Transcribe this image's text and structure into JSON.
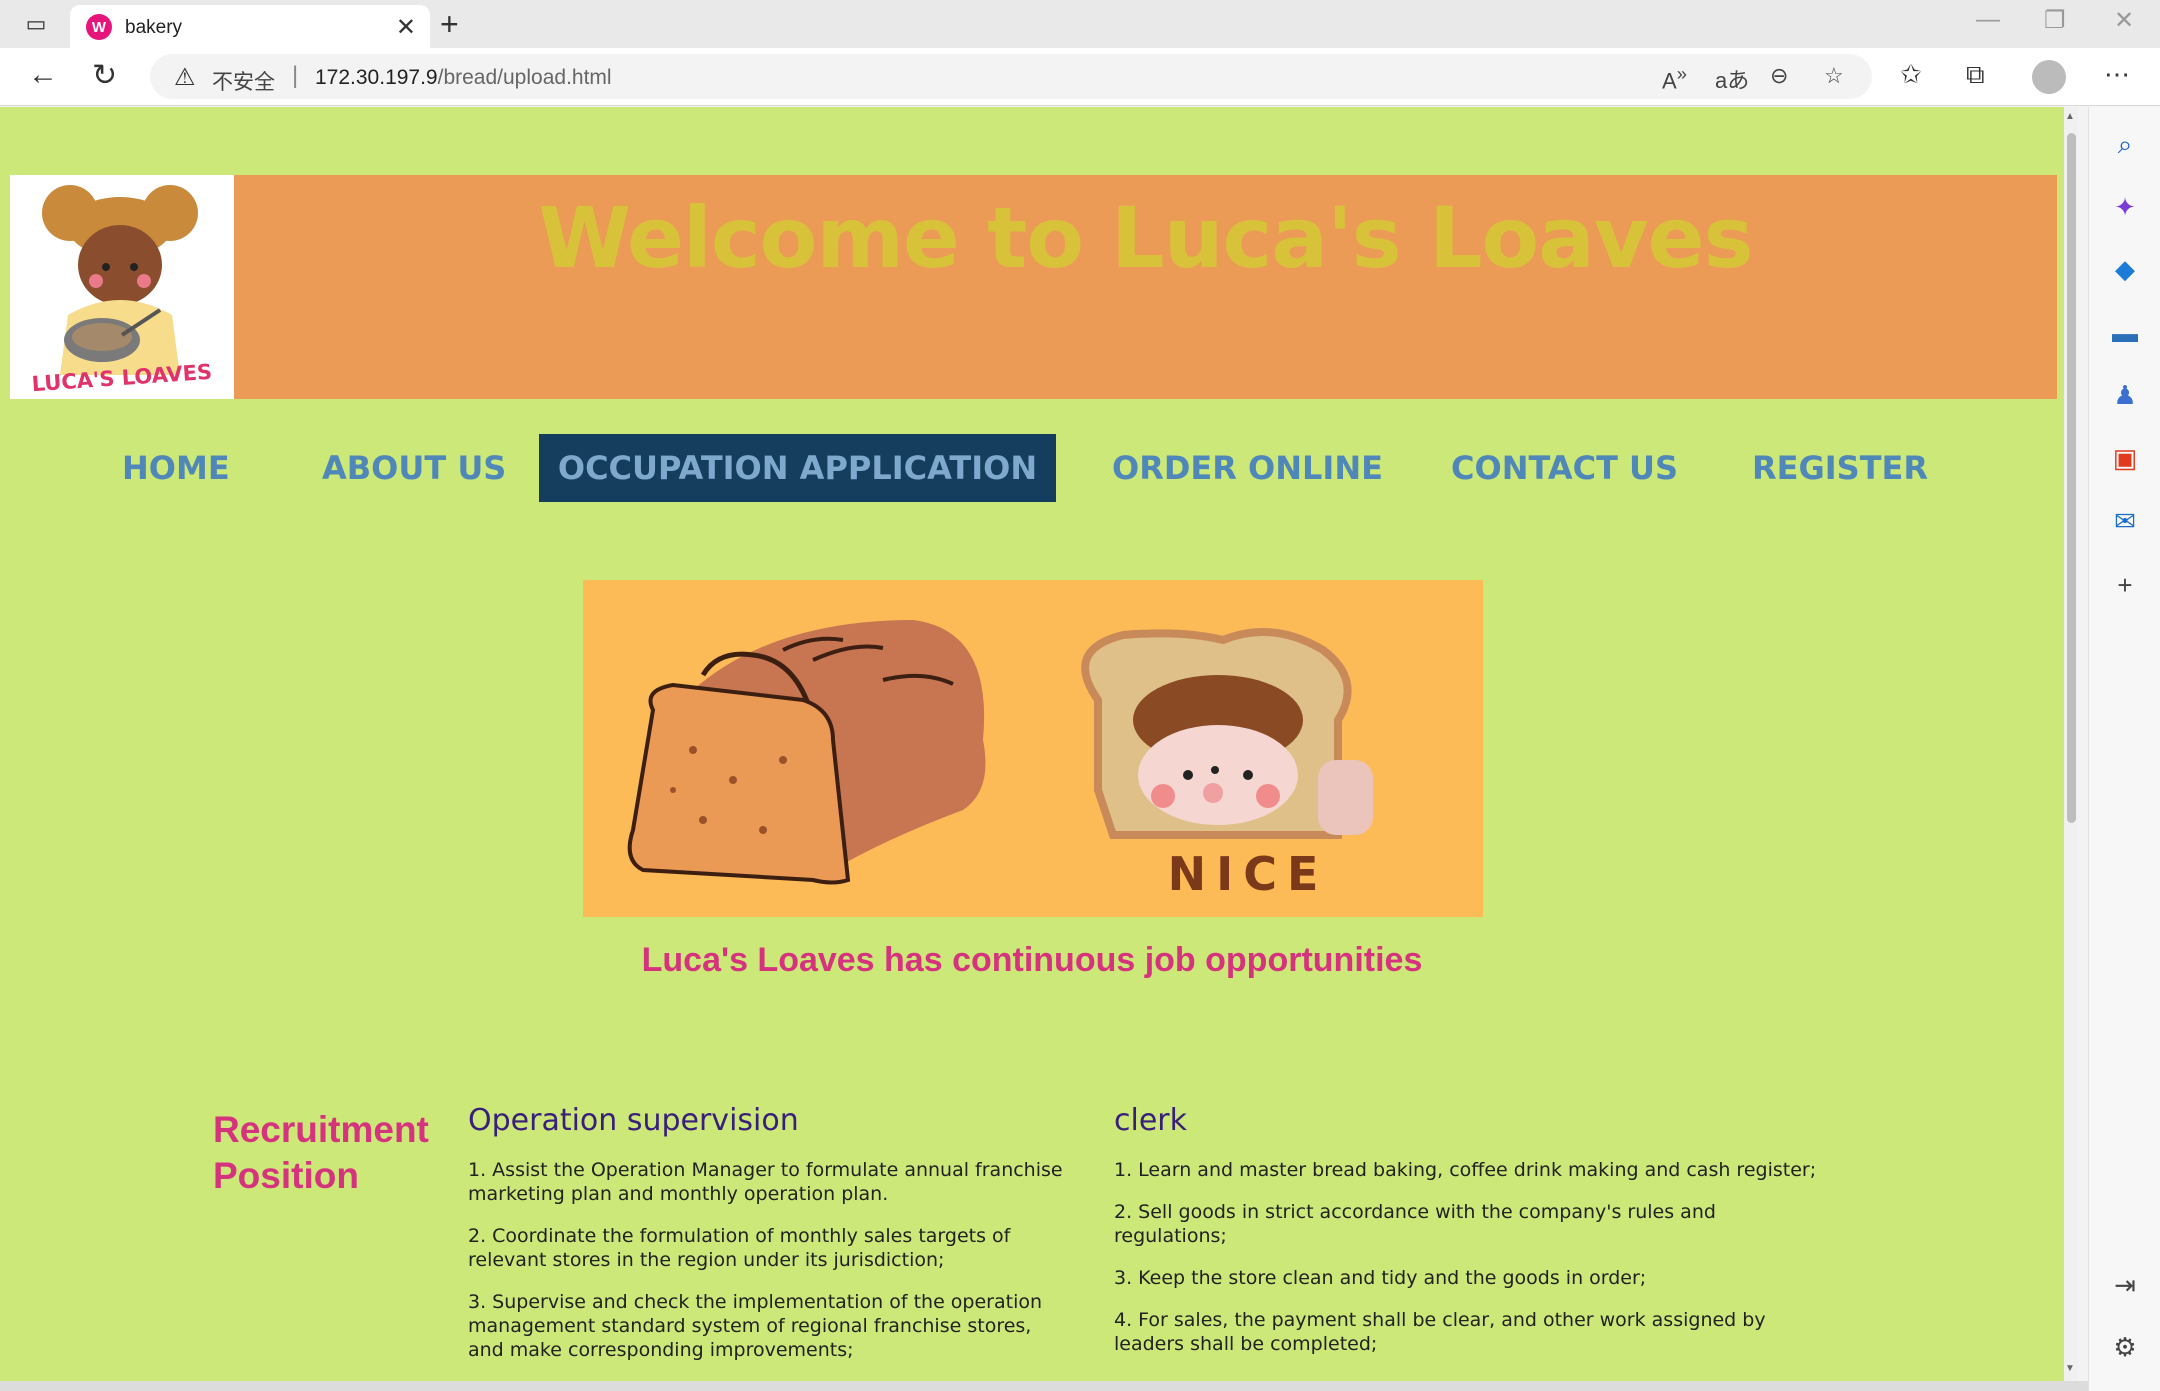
{
  "browser": {
    "tab_title": "bakery",
    "security_label": "不安全",
    "url_host": "172.30.197.9",
    "url_path": "/bread/upload.html"
  },
  "header": {
    "title": "Welcome to Luca's Loaves",
    "logo_text": "LUCA'S LOAVES"
  },
  "nav": {
    "items": [
      "HOME",
      "ABOUT US",
      "OCCUPATION APPLICATION",
      "ORDER ONLINE",
      "CONTACT US",
      "REGISTER"
    ],
    "active": "OCCUPATION APPLICATION"
  },
  "hero": {
    "badge_text": "NICE"
  },
  "tagline": "Luca's Loaves has continuous job opportunities",
  "recruitment": {
    "heading": "Recruitment Position",
    "positions": [
      {
        "title": "Operation supervision",
        "duties": [
          "1. Assist the Operation Manager to formulate annual franchise marketing plan and monthly operation plan.",
          "2. Coordinate the formulation of monthly sales targets of relevant stores in the region under its jurisdiction;",
          "3. Supervise and check the implementation of the operation management standard system of regional franchise stores, and make corresponding improvements;"
        ]
      },
      {
        "title": "clerk",
        "duties": [
          "1. Learn and master bread baking, coffee drink making and cash register;",
          "2. Sell goods in strict accordance with the company's rules and regulations;",
          "3. Keep the store clean and tidy and the goods in order;",
          "4. For sales, the payment shall be clear, and other work assigned by leaders shall be completed;"
        ]
      }
    ]
  },
  "colors": {
    "page_bg": "#cce878",
    "header_bg": "#eb9b55",
    "title": "#d8c23a",
    "nav_text": "#4f87b8",
    "nav_active_bg": "#153e5e",
    "accent_pink": "#d6337f",
    "hero_bg": "#fdbb58"
  }
}
